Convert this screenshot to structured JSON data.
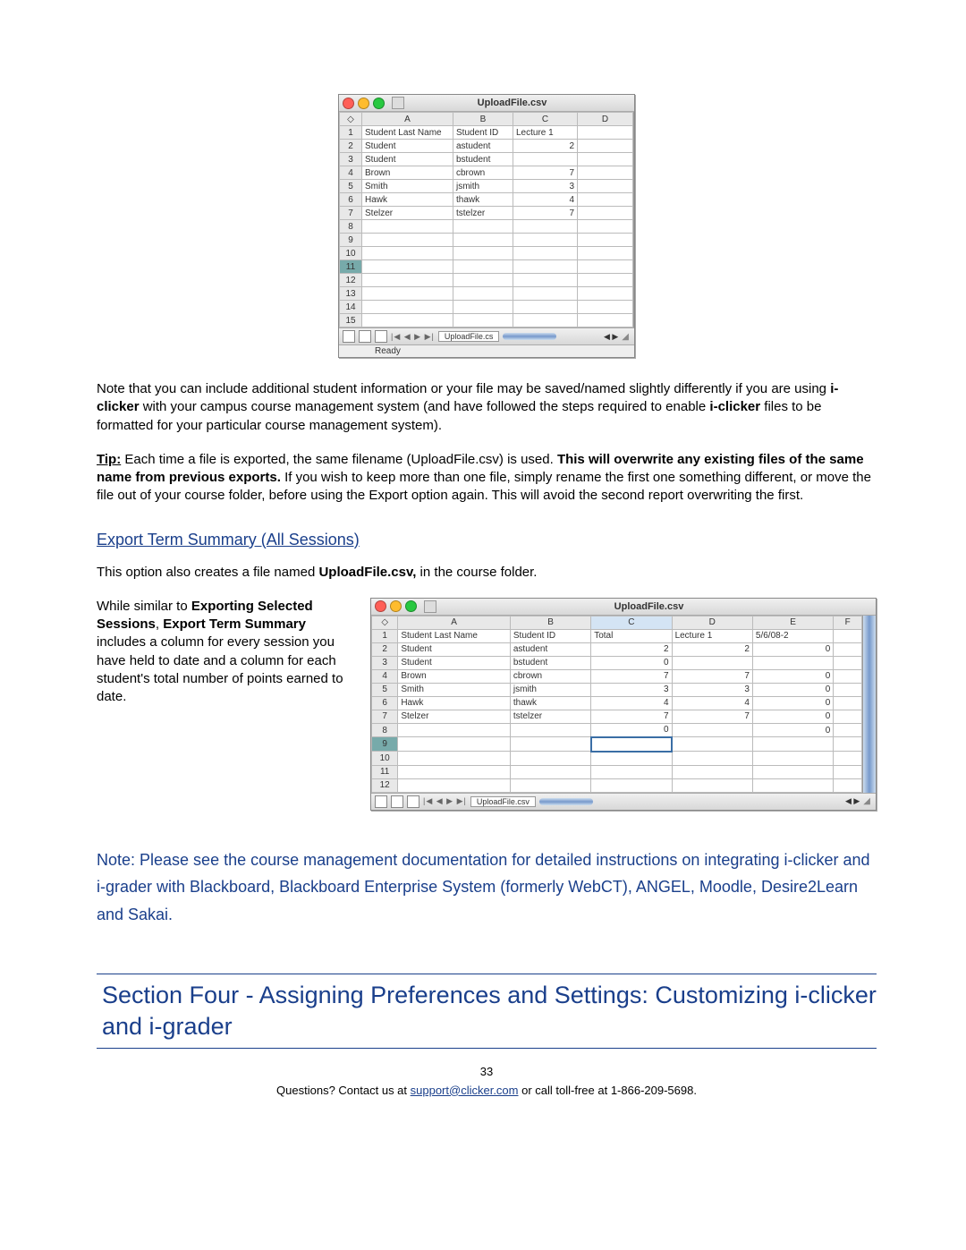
{
  "screenshot1": {
    "title": "UploadFile.csv",
    "columns": [
      "A",
      "B",
      "C",
      "D"
    ],
    "rows": [
      [
        "1",
        "Student Last Name",
        "Student ID",
        "Lecture 1",
        ""
      ],
      [
        "2",
        "Student",
        "astudent",
        "2",
        ""
      ],
      [
        "3",
        "Student",
        "bstudent",
        "",
        ""
      ],
      [
        "4",
        "Brown",
        "cbrown",
        "7",
        ""
      ],
      [
        "5",
        "Smith",
        "jsmith",
        "3",
        ""
      ],
      [
        "6",
        "Hawk",
        "thawk",
        "4",
        ""
      ],
      [
        "7",
        "Stelzer",
        "tstelzer",
        "7",
        ""
      ],
      [
        "8",
        "",
        "",
        "",
        ""
      ],
      [
        "9",
        "",
        "",
        "",
        ""
      ],
      [
        "10",
        "",
        "",
        "",
        ""
      ],
      [
        "11",
        "",
        "",
        "",
        ""
      ],
      [
        "12",
        "",
        "",
        "",
        ""
      ],
      [
        "13",
        "",
        "",
        "",
        ""
      ],
      [
        "14",
        "",
        "",
        "",
        ""
      ],
      [
        "15",
        "",
        "",
        "",
        ""
      ]
    ],
    "sheet_tab": "UploadFile.cs",
    "status": "Ready"
  },
  "para1": {
    "t1": "Note that you can include additional student information or your file may be saved/named slightly differently if you are using ",
    "b1": "i-clicker",
    "t2": " with your campus course management system (and have followed the steps required to enable ",
    "b2": "i-clicker",
    "t3": " files to be formatted for your particular course management system)."
  },
  "para2": {
    "tip_label": "Tip:",
    "t1": " Each time a file is exported, the same filename (UploadFile.csv) is used. ",
    "b1": "This will overwrite any existing files of the same name from previous exports.",
    "t2": "  If you wish to keep more than one file, simply rename the first one something different, or move the file out of your course folder, before using the Export option again. This will avoid the second report overwriting the first."
  },
  "heading_export": "Export Term Summary (All Sessions)",
  "para3": {
    "t1": "This option also creates a file named ",
    "b1": "UploadFile.csv,",
    "t2": " in the course folder."
  },
  "para4": {
    "t1": "While similar to ",
    "b1": "Exporting Selected Sessions",
    "t2": ", ",
    "b2": "Export Term Summary",
    "t3": " includes a column for every session you have held to date and a column for each student's total number of points earned to date."
  },
  "screenshot2": {
    "title": "UploadFile.csv",
    "columns": [
      "A",
      "B",
      "C",
      "D",
      "E",
      "F"
    ],
    "rows": [
      [
        "1",
        "Student Last Name",
        "Student ID",
        "Total",
        "Lecture 1",
        "5/6/08-2",
        ""
      ],
      [
        "2",
        "Student",
        "astudent",
        "2",
        "2",
        "0",
        ""
      ],
      [
        "3",
        "Student",
        "bstudent",
        "0",
        "",
        "",
        ""
      ],
      [
        "4",
        "Brown",
        "cbrown",
        "7",
        "7",
        "0",
        ""
      ],
      [
        "5",
        "Smith",
        "jsmith",
        "3",
        "3",
        "0",
        ""
      ],
      [
        "6",
        "Hawk",
        "thawk",
        "4",
        "4",
        "0",
        ""
      ],
      [
        "7",
        "Stelzer",
        "tstelzer",
        "7",
        "7",
        "0",
        ""
      ],
      [
        "8",
        "",
        "",
        "0",
        "",
        "0",
        ""
      ],
      [
        "9",
        "",
        "",
        "",
        "",
        "",
        ""
      ],
      [
        "10",
        "",
        "",
        "",
        "",
        "",
        ""
      ],
      [
        "11",
        "",
        "",
        "",
        "",
        "",
        ""
      ],
      [
        "12",
        "",
        "",
        "",
        "",
        "",
        ""
      ]
    ],
    "sheet_tab": "UploadFile.csv"
  },
  "note_blue": "Note: Please see the course management documentation for detailed instructions on integrating i-clicker and i-grader with Blackboard, Blackboard Enterprise System (formerly WebCT), ANGEL, Moodle, Desire2Learn and Sakai.",
  "section4": "Section Four - Assigning Preferences and Settings: Customizing i-clicker and i-grader",
  "page_number": "33",
  "footer": {
    "t1": "Questions? Contact us at ",
    "email": "support@clicker.com",
    "t2": " or call toll-free at 1-866-209-5698."
  },
  "nav_glyphs": "|◀ ◀ ▶ ▶|",
  "scroll_arrows": "◀ ▶"
}
